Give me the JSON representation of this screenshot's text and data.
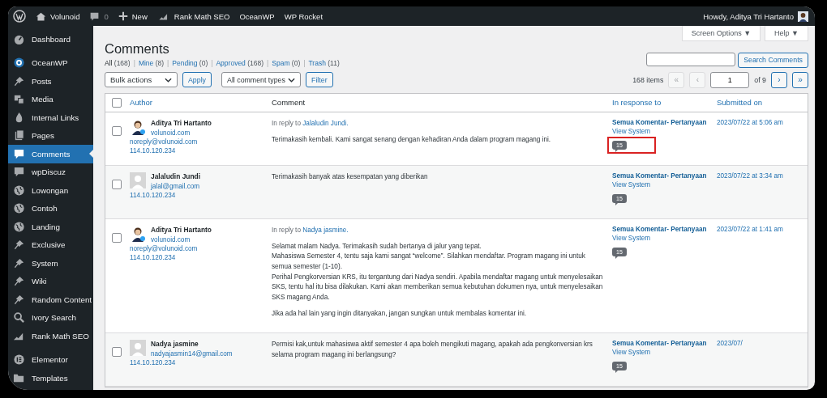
{
  "admin_bar": {
    "site": "Volunoid",
    "comments_count": "0",
    "new": "New",
    "items": [
      "Rank Math SEO",
      "OceanWP",
      "WP Rocket"
    ],
    "greeting": "Howdy, Aditya Tri Hartanto"
  },
  "sidebar": {
    "groups": [
      {
        "items": [
          {
            "label": "Dashboard",
            "selected": false
          }
        ]
      },
      {
        "items": [
          {
            "label": "OceanWP",
            "selected": false
          },
          {
            "label": "Posts",
            "selected": false
          },
          {
            "label": "Media",
            "selected": false
          },
          {
            "label": "Internal Links",
            "selected": false
          },
          {
            "label": "Pages",
            "selected": false
          },
          {
            "label": "Comments",
            "selected": true
          },
          {
            "label": "wpDiscuz",
            "selected": false
          },
          {
            "label": "Lowongan",
            "selected": false
          },
          {
            "label": "Contoh",
            "selected": false
          },
          {
            "label": "Landing",
            "selected": false
          },
          {
            "label": "Exclusive",
            "selected": false
          },
          {
            "label": "System",
            "selected": false
          },
          {
            "label": "Wiki",
            "selected": false
          },
          {
            "label": "Random Content",
            "selected": false
          },
          {
            "label": "Ivory Search",
            "selected": false
          },
          {
            "label": "Rank Math SEO",
            "selected": false
          }
        ]
      },
      {
        "items": [
          {
            "label": "Elementor",
            "selected": false
          },
          {
            "label": "Templates",
            "selected": false
          }
        ]
      }
    ]
  },
  "top_tabs": [
    "Screen Options ▼",
    "Help ▼"
  ],
  "title": "Comments",
  "filters": [
    {
      "label": "All",
      "count": "(168)",
      "selected": true
    },
    {
      "separator": "|",
      "label": "Mine",
      "count": "(8)",
      "selected": false
    },
    {
      "separator": "|",
      "label": "Pending",
      "count": "(0)",
      "selected": false
    },
    {
      "separator": "|",
      "label": "Approved",
      "count": "(168)",
      "selected": false
    },
    {
      "separator": "|",
      "label": "Spam",
      "count": "(0)",
      "selected": false
    },
    {
      "separator": "|",
      "label": "Trash",
      "count": "(11)",
      "selected": false
    }
  ],
  "search_button": "Search Comments",
  "bulk_actions": "Bulk actions",
  "apply": "Apply",
  "comment_types": "All comment types",
  "filter": "Filter",
  "pagination": {
    "items": "168 items",
    "first": "«",
    "prev": "‹",
    "page": "1",
    "of": "of 9",
    "next": "›",
    "last": "»"
  },
  "table": {
    "select_all_checked": false,
    "columns": [
      "Author",
      "Comment",
      "In response to",
      "Submitted on"
    ],
    "rows": [
      {
        "kind": "photo",
        "checked": false,
        "name": "Aditya Tri Hartanto",
        "website": "volunoid.com",
        "email": "noreply@volunoid.com",
        "ip": "114.10.120.234",
        "reply_prefix": "In reply to",
        "reply_to": "Jalaludin Jundi.",
        "paragraphs": [
          "Terimakasih kembali. Kami sangat senang dengan kehadiran Anda dalam program magang ini."
        ],
        "post": "Semua Komentar- Pertanyaan",
        "view": "View System",
        "count": "15",
        "highlighted": true,
        "date": "2023/07/22 at 5:06 am"
      },
      {
        "kind": "default",
        "checked": false,
        "name": "Jalaludin Jundi",
        "email": "jalal@gmail.com",
        "ip": "114.10.120.234",
        "paragraphs": [
          "Terimakasih banyak atas kesempatan yang diberikan"
        ],
        "post": "Semua Komentar- Pertanyaan",
        "view": "View System",
        "count": "15",
        "highlighted": false,
        "date": "2023/07/22 at 3:34 am"
      },
      {
        "kind": "photo",
        "checked": false,
        "name": "Aditya Tri Hartanto",
        "website": "volunoid.com",
        "email": "noreply@volunoid.com",
        "ip": "114.10.120.234",
        "reply_prefix": "In reply to",
        "reply_to": "Nadya jasmine.",
        "paragraphs": [
          "Selamat malam Nadya. Terimakasih sudah bertanya di jalur yang tepat.\nMahasiswa Semester 4, tentu saja kami sangat “welcome”. Silahkan mendaftar. Program magang ini untuk semua semester (1-10).\nPerihal Pengkorversian KRS, itu tergantung dari Nadya sendiri. Apabila mendaftar magang untuk menyelesaikan SKS, tentu hal itu bisa dilakukan. Kami akan memberikan semua kebutuhan dokumen nya, untuk menyelesaikan SKS magang Anda.",
          "Jika ada hal lain yang ingin ditanyakan, jangan sungkan untuk membalas komentar ini."
        ],
        "post": "Semua Komentar- Pertanyaan",
        "view": "View System",
        "count": "15",
        "highlighted": false,
        "date": "2023/07/22 at 1:41 am"
      },
      {
        "kind": "default",
        "checked": false,
        "name": "Nadya jasmine",
        "email": "nadyajasmin14@gmail.com",
        "ip": "114.10.120.234",
        "paragraphs": [
          "Permisi kak,untuk mahasiswa aktif semester 4 apa boleh mengikuti magang, apakah ada pengkonversian krs selama program magang ini berlangsung?"
        ],
        "post": "Semua Komentar- Pertanyaan",
        "view": "View System",
        "count": "15",
        "highlighted": false,
        "date": "2023/07/"
      }
    ]
  }
}
